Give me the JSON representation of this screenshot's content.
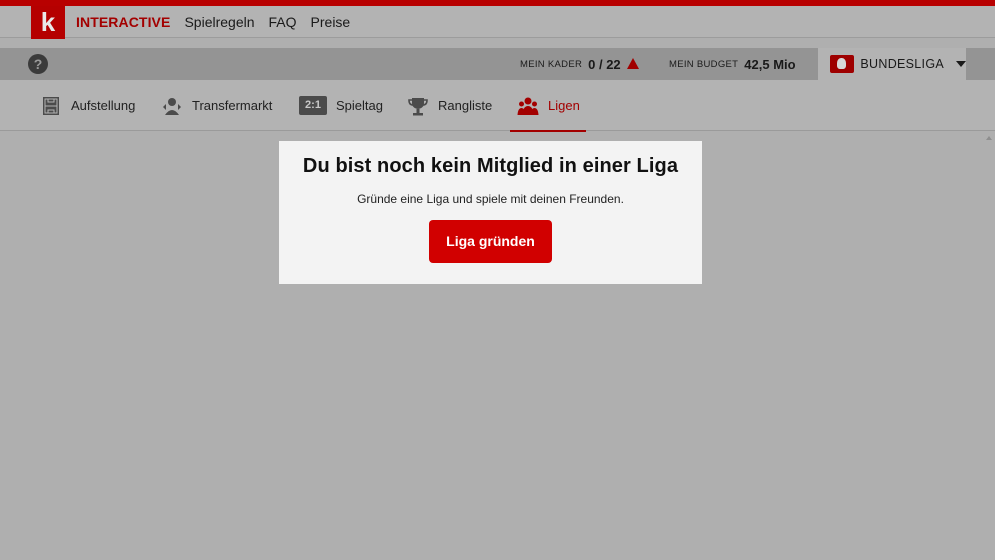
{
  "header": {
    "logo_letter": "k",
    "brand": "INTERACTIVE",
    "nav": [
      "Spielregeln",
      "FAQ",
      "Preise"
    ]
  },
  "infobar": {
    "help_icon": "question-circle-icon",
    "kader_label": "MEIN KADER",
    "kader_value": "0 / 22",
    "budget_label": "MEIN BUDGET",
    "budget_value": "42,5 Mio",
    "league": "BUNDESLIGA"
  },
  "tabs": [
    {
      "label": "Aufstellung",
      "icon": "lineup-icon"
    },
    {
      "label": "Transfermarkt",
      "icon": "transfer-icon"
    },
    {
      "label": "Spieltag",
      "icon": "scoreboard-icon",
      "badge": "2:1"
    },
    {
      "label": "Rangliste",
      "icon": "trophy-icon"
    },
    {
      "label": "Ligen",
      "icon": "group-icon",
      "active": true
    }
  ],
  "empty_state": {
    "title": "Du bist noch kein Mitglied in einer Liga",
    "text": "Gründe eine Liga und spiele mit deinen Freunden.",
    "button": "Liga gründen"
  },
  "colors": {
    "accent": "#a30000",
    "button": "#d10000",
    "overlay": "#afafaf"
  }
}
